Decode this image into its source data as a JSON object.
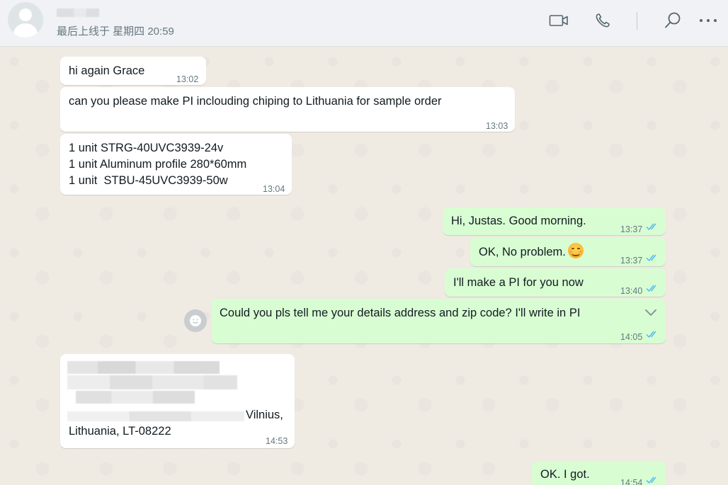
{
  "header": {
    "last_seen": "最后上线于 星期四 20:59",
    "icons": [
      "video-call-icon",
      "voice-call-icon",
      "search-icon",
      "more-menu-icon"
    ]
  },
  "colors": {
    "incoming_bubble": "#ffffff",
    "outgoing_bubble": "#d9fdd3",
    "read_ticks": "#53bdeb",
    "chat_background": "#efeae2",
    "header_background": "#f0f2f5"
  },
  "messages": [
    {
      "direction": "in",
      "text": "hi again Grace",
      "time": "13:02"
    },
    {
      "direction": "in",
      "text": "can you please make PI inclouding chiping to Lithuania for sample order",
      "time": "13:03"
    },
    {
      "direction": "in",
      "lines": [
        "1 unit STRG-40UVC3939-24v",
        "1 unit Aluminum profile 280*60mm",
        "1 unit  STBU-45UVC3939-50w"
      ],
      "time": "13:04"
    },
    {
      "direction": "out",
      "text": "Hi, Justas. Good morning.",
      "time": "13:37",
      "status": "read"
    },
    {
      "direction": "out",
      "text": "OK, No problem.",
      "emoji": "smiling-face-emoji",
      "time": "13:37",
      "status": "read"
    },
    {
      "direction": "out",
      "text": "I'll make a PI for you now",
      "time": "13:40",
      "status": "read"
    },
    {
      "direction": "out",
      "text": "Could you pls tell me your details address and zip code? I'll write in PI",
      "time": "14:05",
      "status": "read"
    },
    {
      "direction": "in",
      "lines": [
        "Vilnius,",
        "Lithuania, LT-08222"
      ],
      "time": "14:53"
    },
    {
      "direction": "out",
      "text": "OK. I got.",
      "time": "14:54",
      "status": "read"
    }
  ]
}
